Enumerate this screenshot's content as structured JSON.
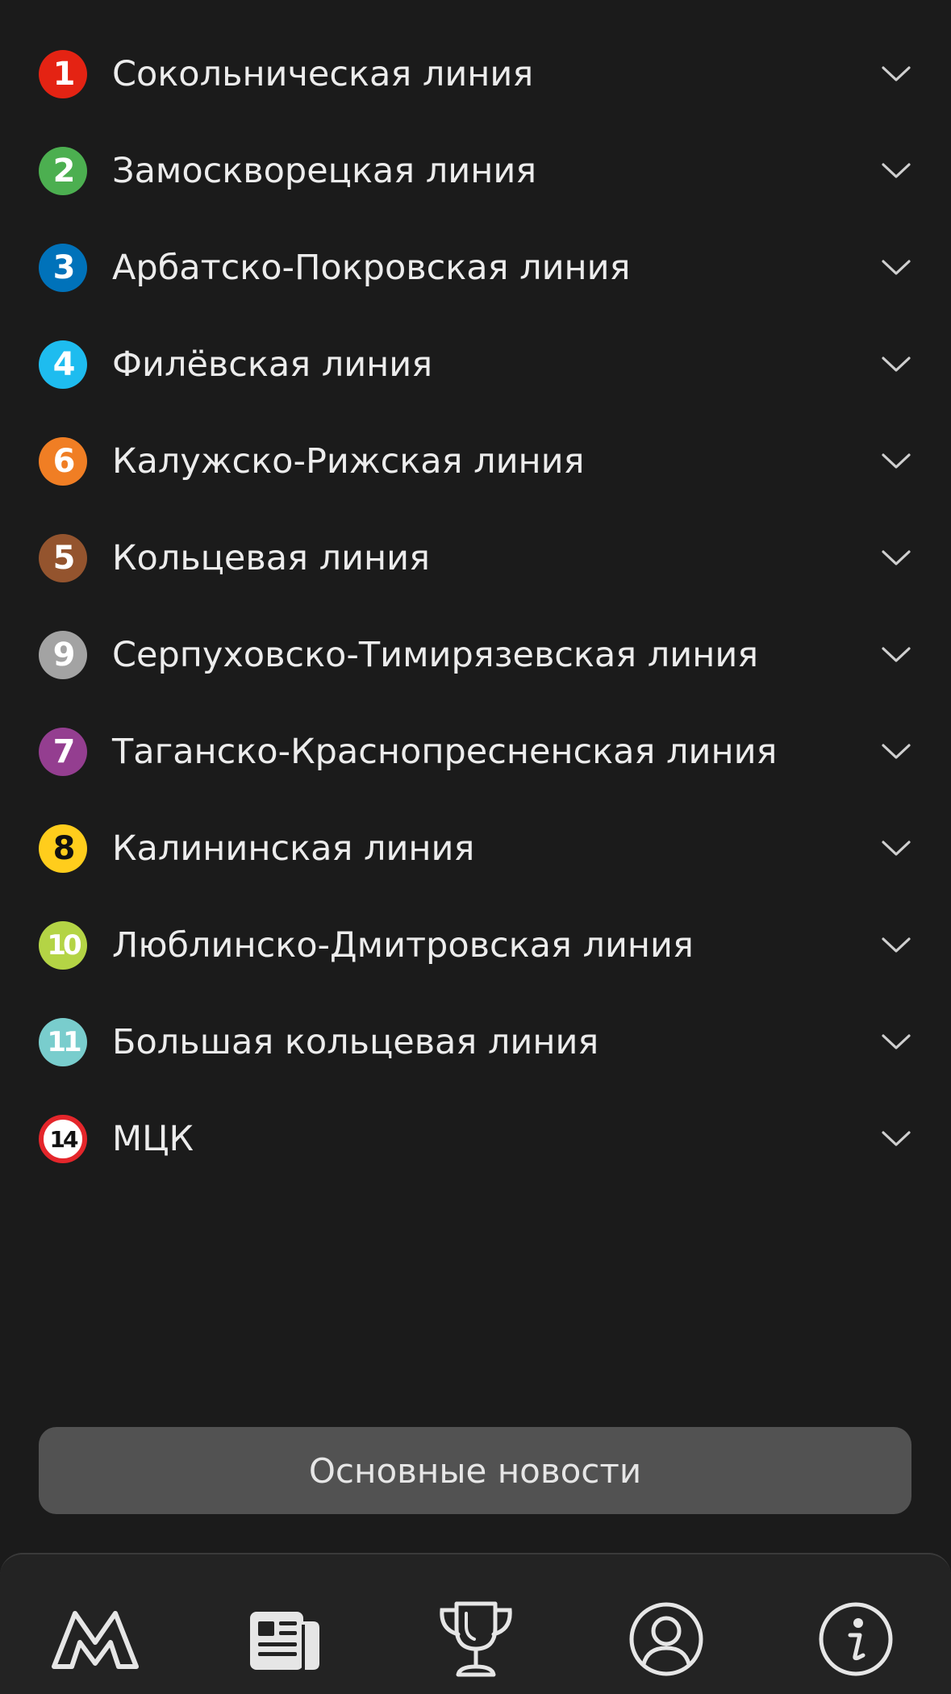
{
  "lines": [
    {
      "number": "1",
      "name": "Сокольническая линия",
      "color": "#e42313",
      "text_color": "#ffffff",
      "icon": "chevron-down-icon"
    },
    {
      "number": "2",
      "name": "Замоскворецкая линия",
      "color": "#4caf50",
      "text_color": "#ffffff",
      "icon": "chevron-down-icon"
    },
    {
      "number": "3",
      "name": "Арбатско-Покровская линия",
      "color": "#0072ba",
      "text_color": "#ffffff",
      "icon": "chevron-down-icon"
    },
    {
      "number": "4",
      "name": "Филёвская линия",
      "color": "#1ebcef",
      "text_color": "#ffffff",
      "icon": "chevron-down-icon"
    },
    {
      "number": "6",
      "name": "Калужско-Рижская линия",
      "color": "#f07e24",
      "text_color": "#ffffff",
      "icon": "chevron-down-icon"
    },
    {
      "number": "5",
      "name": "Кольцевая линия",
      "color": "#94542e",
      "text_color": "#ffffff",
      "icon": "chevron-down-icon"
    },
    {
      "number": "9",
      "name": "Серпуховско-Тимирязевская линия",
      "color": "#a3a3a3",
      "text_color": "#ffffff",
      "icon": "chevron-down-icon"
    },
    {
      "number": "7",
      "name": "Таганско-Краснопресненская линия",
      "color": "#943e90",
      "text_color": "#ffffff",
      "icon": "chevron-down-icon"
    },
    {
      "number": "8",
      "name": "Калининская линия",
      "color": "#ffcd1c",
      "text_color": "#111111",
      "icon": "chevron-down-icon"
    },
    {
      "number": "10",
      "name": "Люблинско-Дмитровская линия",
      "color": "#b4d445",
      "text_color": "#ffffff",
      "icon": "chevron-down-icon"
    },
    {
      "number": "11",
      "name": "Большая кольцевая линия",
      "color": "#79cdcd",
      "text_color": "#ffffff",
      "icon": "chevron-down-icon"
    },
    {
      "number": "14",
      "name": "МЦК",
      "color": "#ffffff",
      "text_color": "#111111",
      "border_color": "#e4262b",
      "icon": "chevron-down-icon"
    }
  ],
  "news_button": {
    "label": "Основные новости"
  },
  "tabbar": {
    "tabs": [
      {
        "icon": "metro-logo-icon"
      },
      {
        "icon": "newspaper-icon"
      },
      {
        "icon": "trophy-icon"
      },
      {
        "icon": "profile-icon"
      },
      {
        "icon": "info-icon"
      }
    ]
  },
  "colors": {
    "background": "#1b1b1b",
    "tabbar_background": "#232323",
    "button_background": "#525252",
    "text": "#ececec",
    "icon": "#e6e6e6"
  }
}
